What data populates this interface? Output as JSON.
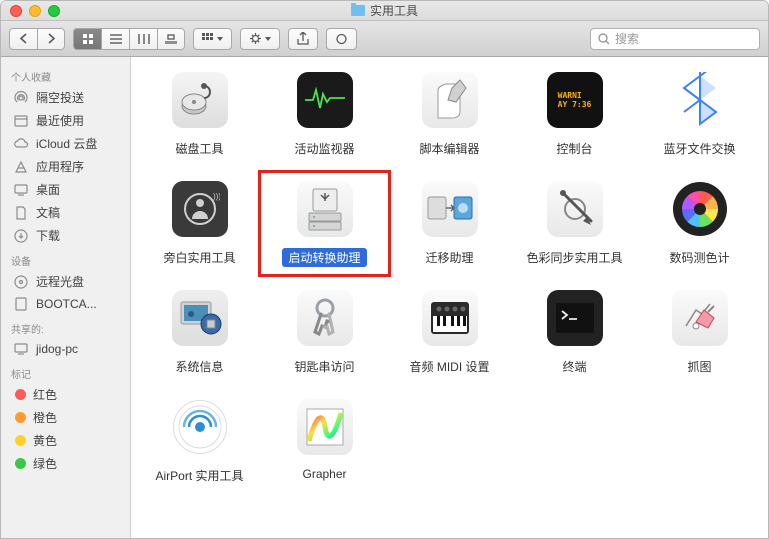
{
  "window": {
    "title": "实用工具"
  },
  "search": {
    "placeholder": "搜索"
  },
  "sidebar": {
    "favorites": {
      "header": "个人收藏",
      "items": [
        "隔空投送",
        "最近使用",
        "iCloud 云盘",
        "应用程序",
        "桌面",
        "文稿",
        "下载"
      ]
    },
    "devices": {
      "header": "设备",
      "items": [
        "远程光盘",
        "BOOTCA..."
      ]
    },
    "shared": {
      "header": "共享的:",
      "items": [
        "jidog-pc"
      ]
    },
    "tags": {
      "header": "标记",
      "items": [
        {
          "label": "红色",
          "color": "#ff5b56"
        },
        {
          "label": "橙色",
          "color": "#ff9b34"
        },
        {
          "label": "黄色",
          "color": "#ffd129"
        },
        {
          "label": "绿色",
          "color": "#3ec648"
        }
      ]
    }
  },
  "grid": {
    "items": [
      {
        "id": "disk-utility",
        "label": "磁盘工具"
      },
      {
        "id": "activity-monitor",
        "label": "活动监视器"
      },
      {
        "id": "script-editor",
        "label": "脚本编辑器"
      },
      {
        "id": "console",
        "label": "控制台"
      },
      {
        "id": "bluetooth-exchange",
        "label": "蓝牙文件交换"
      },
      {
        "id": "voiceover-utility",
        "label": "旁白实用工具"
      },
      {
        "id": "boot-camp",
        "label": "启动转换助理",
        "selected": true,
        "highlight": true
      },
      {
        "id": "migration-assistant",
        "label": "迁移助理"
      },
      {
        "id": "colorsync-utility",
        "label": "色彩同步实用工具"
      },
      {
        "id": "digital-color-meter",
        "label": "数码测色计"
      },
      {
        "id": "system-info",
        "label": "系统信息"
      },
      {
        "id": "keychain-access",
        "label": "钥匙串访问"
      },
      {
        "id": "audio-midi",
        "label": "音频 MIDI 设置"
      },
      {
        "id": "terminal",
        "label": "终端"
      },
      {
        "id": "grab",
        "label": "抓图"
      },
      {
        "id": "airport-utility",
        "label": "AirPort 实用工具"
      },
      {
        "id": "grapher",
        "label": "Grapher"
      }
    ]
  },
  "console_text": "WARNI\nAY 7:36"
}
